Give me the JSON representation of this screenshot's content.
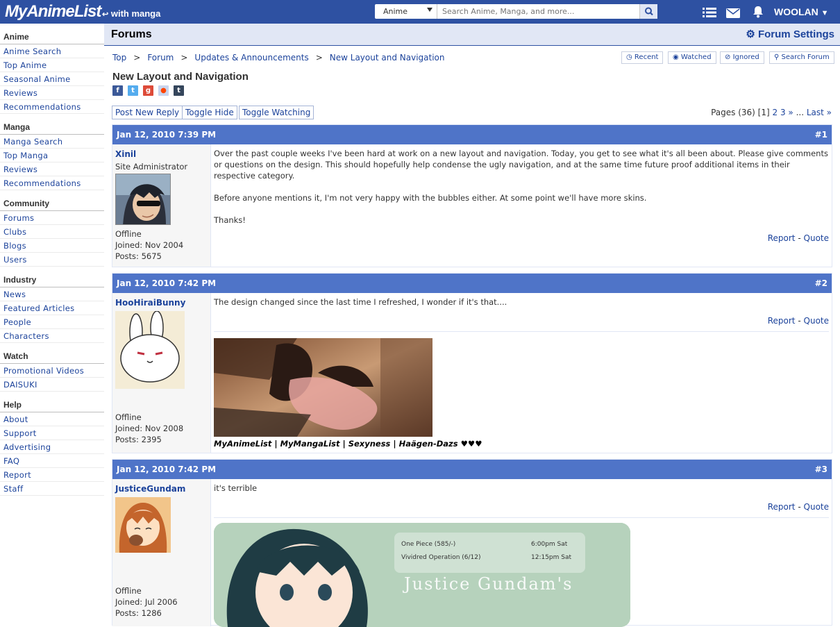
{
  "header": {
    "logo_text": "MyAnimeList",
    "logo_sub": "with manga",
    "search_category": "Anime",
    "search_placeholder": "Search Anime, Manga, and more...",
    "username": "WOOLAN"
  },
  "sidebar": {
    "sections": [
      {
        "title": "Anime",
        "items": [
          "Anime Search",
          "Top Anime",
          "Seasonal Anime",
          "Reviews",
          "Recommendations"
        ]
      },
      {
        "title": "Manga",
        "items": [
          "Manga Search",
          "Top Manga",
          "Reviews",
          "Recommendations"
        ]
      },
      {
        "title": "Community",
        "items": [
          "Forums",
          "Clubs",
          "Blogs",
          "Users"
        ]
      },
      {
        "title": "Industry",
        "items": [
          "News",
          "Featured Articles",
          "People",
          "Characters"
        ]
      },
      {
        "title": "Watch",
        "items": [
          "Promotional Videos",
          "DAISUKI"
        ]
      },
      {
        "title": "Help",
        "items": [
          "About",
          "Support",
          "Advertising",
          "FAQ",
          "Report",
          "Staff"
        ]
      }
    ]
  },
  "forum": {
    "title": "Forums",
    "settings_label": "Forum Settings",
    "breadcrumb": [
      "Top",
      "Forum",
      "Updates & Announcements",
      "New Layout and Navigation"
    ],
    "tools": [
      "Recent",
      "Watched",
      "Ignored",
      "Search Forum"
    ],
    "topic_title": "New Layout and Navigation",
    "actions": [
      "Post New Reply",
      "Toggle Hide",
      "Toggle Watching"
    ],
    "pages": {
      "prefix": "Pages (36) ",
      "current": "[1]",
      "links": [
        "2",
        "3",
        "»"
      ],
      "ellipsis": " ... ",
      "last": "Last »"
    }
  },
  "posts": [
    {
      "date": "Jan 12, 2010 7:39 PM",
      "number": "#1",
      "user": "Xinil",
      "role": "Site Administrator",
      "status": "Offline",
      "joined": "Joined: Nov 2004",
      "posts": "Posts: 5675",
      "body": [
        "Over the past couple weeks I've been hard at work on a new layout and navigation. Today, you get to see what it's all been about. Please give comments or questions on the design. This should hopefully help condense the ugly navigation, and at the same time future proof additional items in their respective category.",
        "Before anyone mentions it, I'm not very happy with the bubbles either. At some point we'll have more skins.",
        "Thanks!"
      ],
      "report": "Report",
      "quote": "Quote"
    },
    {
      "date": "Jan 12, 2010 7:42 PM",
      "number": "#2",
      "user": "HooHiraiBunny",
      "status": "Offline",
      "joined": "Joined: Nov 2008",
      "posts": "Posts: 2395",
      "body": [
        "The design changed since the last time I refreshed, I wonder if it's that...."
      ],
      "signature": "MyAnimeList | MyMangaList | Sexyness | Haägen-Dazs ♥♥♥",
      "report": "Report",
      "quote": "Quote"
    },
    {
      "date": "Jan 12, 2010 7:42 PM",
      "number": "#3",
      "user": "JusticeGundam",
      "status": "Offline",
      "joined": "Joined: Jul 2006",
      "posts": "Posts: 1286",
      "body": [
        "it's terrible"
      ],
      "banner": {
        "rows": [
          {
            "show": "One Piece (585/-)",
            "time": "6:00pm Sat"
          },
          {
            "show": "Vividred Operation (6/12)",
            "time": "12:15pm Sat"
          }
        ],
        "caption": "Justice Gundam's"
      },
      "report": "Report",
      "quote": "Quote"
    }
  ]
}
